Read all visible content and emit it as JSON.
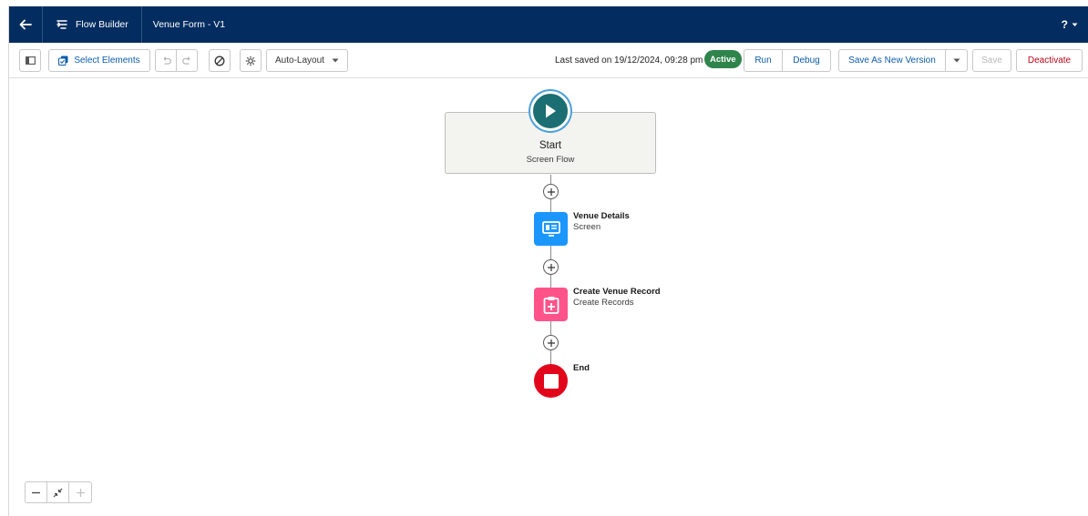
{
  "header": {
    "app_title": "Flow Builder",
    "document_title": "Venue Form - V1",
    "help_label": "?",
    "back_icon": "arrow-left-icon",
    "app_icon": "flow-icon"
  },
  "toolbar": {
    "select_elements_label": "Select Elements",
    "layout_select_value": "Auto-Layout",
    "last_saved_text": "Last saved on 19/12/2024, 09:28 pm",
    "status_badge": "Active",
    "run_label": "Run",
    "debug_label": "Debug",
    "save_as_new_version_label": "Save As New Version",
    "save_label": "Save",
    "deactivate_label": "Deactivate"
  },
  "canvas": {
    "start": {
      "title": "Start",
      "subtitle": "Screen Flow"
    },
    "nodes": [
      {
        "title": "Venue Details",
        "subtitle": "Screen",
        "icon": "screen-icon",
        "color": "#1b96ff"
      },
      {
        "title": "Create Venue Record",
        "subtitle": "Create Records",
        "icon": "create-record-icon",
        "color": "#ff538a"
      },
      {
        "title": "End",
        "subtitle": "",
        "icon": "stop-icon",
        "color": "#e2061a"
      }
    ]
  },
  "colors": {
    "header_bg": "#032d60",
    "active_badge": "#2e844a",
    "start_circle": "#1b6e72",
    "link_blue": "#0b5cab",
    "deactivate_red": "#ba0517"
  }
}
